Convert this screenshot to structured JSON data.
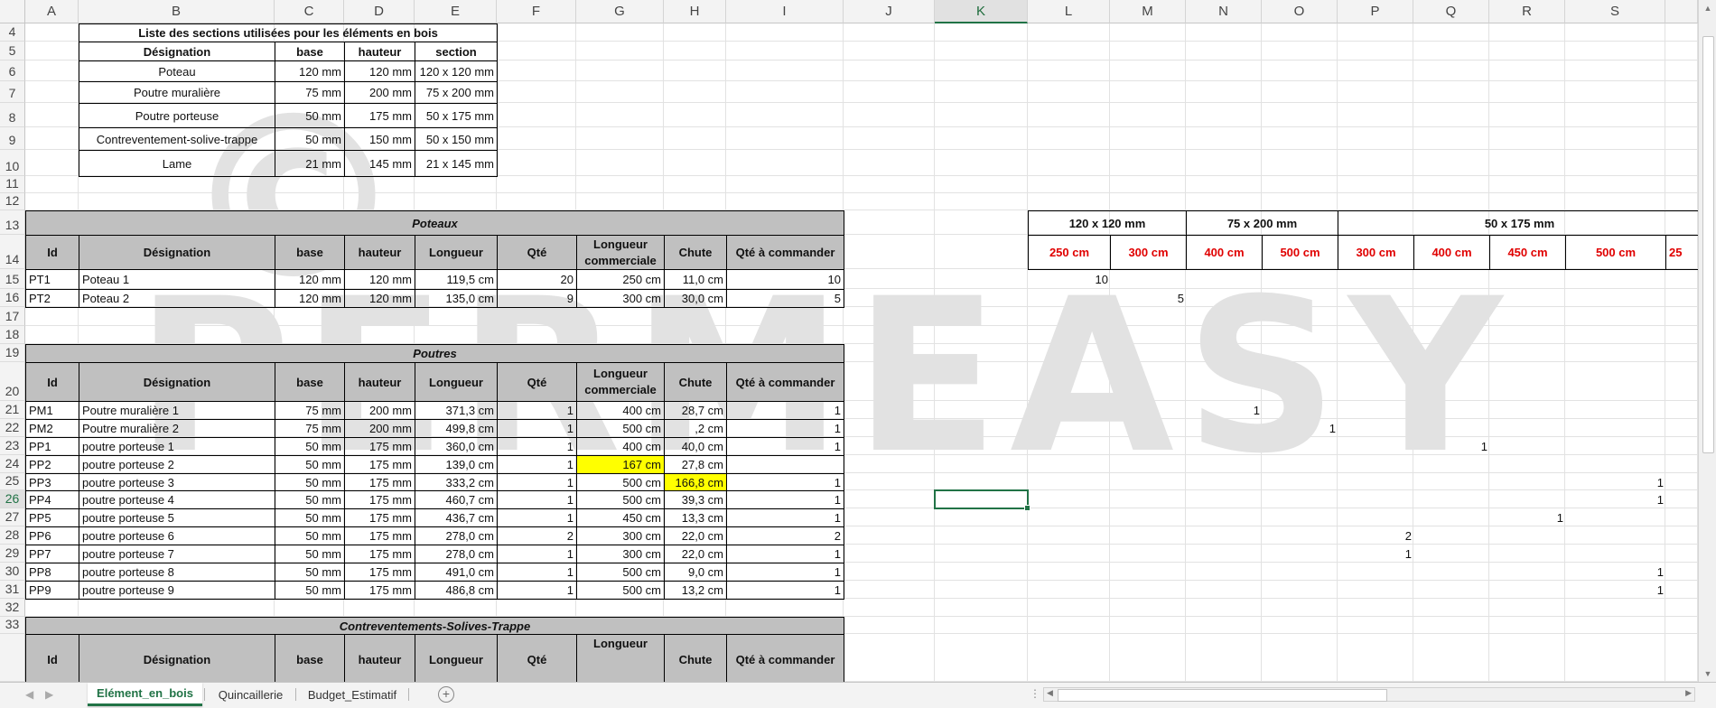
{
  "columns": [
    "A",
    "B",
    "C",
    "D",
    "E",
    "F",
    "G",
    "H",
    "I",
    "J",
    "K",
    "L",
    "M",
    "N",
    "O",
    "P",
    "Q",
    "R",
    "S",
    ""
  ],
  "selected_column": "K",
  "rows": [
    "4",
    "5",
    "6",
    "7",
    "8",
    "9",
    "10",
    "11",
    "12",
    "13",
    "14",
    "15",
    "16",
    "17",
    "18",
    "19",
    "20",
    "21",
    "22",
    "23",
    "24",
    "25",
    "26",
    "27",
    "28",
    "29",
    "30",
    "31",
    "32",
    "33",
    ""
  ],
  "selected_row": "26",
  "watermark": {
    "copyright": "©",
    "brand": "PERMEASY"
  },
  "sections_table": {
    "title": "Liste des sections utilisées pour les éléments en bois",
    "headers": [
      "Désignation",
      "base",
      "hauteur",
      "section"
    ],
    "rows": [
      [
        "Poteau",
        "120 mm",
        "120 mm",
        "120 x 120 mm"
      ],
      [
        "Poutre muralière",
        "75 mm",
        "200 mm",
        "75 x 200 mm"
      ],
      [
        "Poutre porteuse",
        "50 mm",
        "175 mm",
        "50 x 175 mm"
      ],
      [
        "Contreventement-solive-trappe",
        "50 mm",
        "150 mm",
        "50 x 150 mm"
      ],
      [
        "Lame",
        "21 mm",
        "145 mm",
        "21 x 145 mm"
      ]
    ]
  },
  "table_headers": [
    "Id",
    "Désignation",
    "base",
    "hauteur",
    "Longueur",
    "Qté",
    "Longueur commerciale",
    "Chute",
    "Qté à commander"
  ],
  "poteaux": {
    "title": "Poteaux",
    "rows": [
      [
        "PT1",
        "Poteau 1",
        "120 mm",
        "120 mm",
        "119,5 cm",
        "20",
        "250 cm",
        "11,0 cm",
        "10"
      ],
      [
        "PT2",
        "Poteau 2",
        "120 mm",
        "120 mm",
        "135,0 cm",
        "9",
        "300 cm",
        "30,0 cm",
        "5"
      ]
    ]
  },
  "poutres": {
    "title": "Poutres",
    "rows": [
      [
        "PM1",
        "Poutre muralière 1",
        "75 mm",
        "200 mm",
        "371,3 cm",
        "1",
        "400 cm",
        "28,7 cm",
        "1"
      ],
      [
        "PM2",
        "Poutre muralière 2",
        "75 mm",
        "200 mm",
        "499,8 cm",
        "1",
        "500 cm",
        ",2 cm",
        "1"
      ],
      [
        "PP1",
        "poutre porteuse 1",
        "50 mm",
        "175 mm",
        "360,0 cm",
        "1",
        "400 cm",
        "40,0 cm",
        "1"
      ],
      [
        "PP2",
        "poutre porteuse 2",
        "50 mm",
        "175 mm",
        "139,0 cm",
        "1",
        "167 cm",
        "27,8 cm",
        ""
      ],
      [
        "PP3",
        "poutre porteuse 3",
        "50 mm",
        "175 mm",
        "333,2 cm",
        "1",
        "500 cm",
        "166,8 cm",
        "1"
      ],
      [
        "PP4",
        "poutre porteuse 4",
        "50 mm",
        "175 mm",
        "460,7 cm",
        "1",
        "500 cm",
        "39,3 cm",
        "1"
      ],
      [
        "PP5",
        "poutre porteuse 5",
        "50 mm",
        "175 mm",
        "436,7 cm",
        "1",
        "450 cm",
        "13,3 cm",
        "1"
      ],
      [
        "PP6",
        "poutre porteuse 6",
        "50 mm",
        "175 mm",
        "278,0 cm",
        "2",
        "300 cm",
        "22,0 cm",
        "2"
      ],
      [
        "PP7",
        "poutre porteuse 7",
        "50 mm",
        "175 mm",
        "278,0 cm",
        "1",
        "300 cm",
        "22,0 cm",
        "1"
      ],
      [
        "PP8",
        "poutre porteuse 8",
        "50 mm",
        "175 mm",
        "491,0 cm",
        "1",
        "500 cm",
        "9,0 cm",
        "1"
      ],
      [
        "PP9",
        "poutre porteuse 9",
        "50 mm",
        "175 mm",
        "486,8 cm",
        "1",
        "500 cm",
        "13,2 cm",
        "1"
      ]
    ]
  },
  "contreventements": {
    "title": "Contreventements-Solives-Trappe",
    "header_partial": [
      "Id",
      "Désignation",
      "base",
      "hauteur",
      "Longueur",
      "Qté",
      "Longueur",
      "Chute",
      "Qté à commander"
    ]
  },
  "right_table": {
    "groups": [
      "120 x 120 mm",
      "75 x 200 mm",
      "50 x 175 mm"
    ],
    "lengths": [
      "250 cm",
      "300 cm",
      "400 cm",
      "500 cm",
      "300 cm",
      "400 cm",
      "450 cm",
      "500 cm",
      "25"
    ],
    "values": [
      {
        "row": "15",
        "col": "L",
        "v": "10"
      },
      {
        "row": "16",
        "col": "M",
        "v": "5"
      },
      {
        "row": "21",
        "col": "N",
        "v": "1"
      },
      {
        "row": "22",
        "col": "O",
        "v": "1"
      },
      {
        "row": "23",
        "col": "Q",
        "v": "1"
      },
      {
        "row": "25",
        "col": "S",
        "v": "1"
      },
      {
        "row": "26",
        "col": "S",
        "v": "1"
      },
      {
        "row": "27",
        "col": "R",
        "v": "1"
      },
      {
        "row": "28",
        "col": "P",
        "v": "2"
      },
      {
        "row": "29",
        "col": "P",
        "v": "1"
      },
      {
        "row": "30",
        "col": "S",
        "v": "1"
      },
      {
        "row": "31",
        "col": "S",
        "v": "1"
      }
    ]
  },
  "sheet_tabs": [
    {
      "label": "Elément_en_bois",
      "active": true
    },
    {
      "label": "Quincaillerie",
      "active": false
    },
    {
      "label": "Budget_Estimatif",
      "active": false
    }
  ],
  "colors": {
    "accent": "#217346",
    "header_fill": "#c0c0c0",
    "highlight": "#ffff00",
    "red_text": "#e00000"
  }
}
